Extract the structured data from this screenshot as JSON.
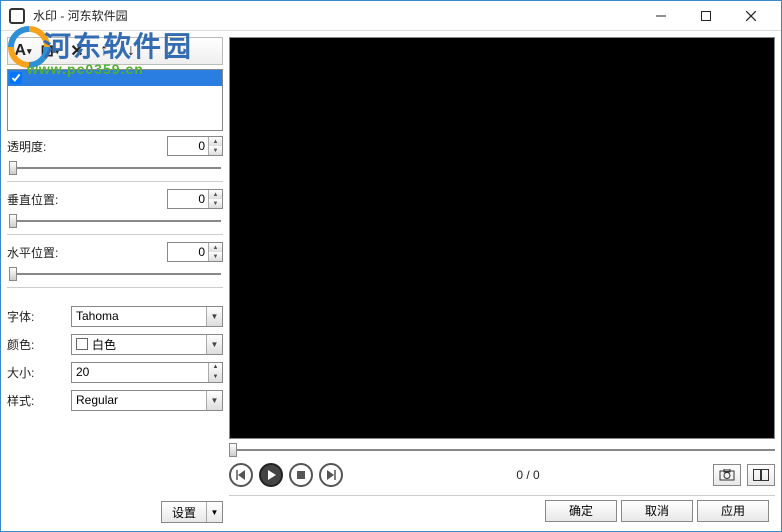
{
  "window": {
    "title": "水印 - 河东软件园"
  },
  "watermark": {
    "text": "河东软件园",
    "url": "www.pc0359.cn"
  },
  "toolbar": {
    "text_tool": "A",
    "image_tool": "⊡",
    "delete_tool": "✕",
    "up_tool": "↑",
    "down_tool": "↓"
  },
  "list": {
    "items": [
      {
        "checked": true,
        "label": ""
      }
    ]
  },
  "sliders": {
    "opacity": {
      "label": "透明度:",
      "value": "0"
    },
    "vpos": {
      "label": "垂直位置:",
      "value": "0"
    },
    "hpos": {
      "label": "水平位置:",
      "value": "0"
    }
  },
  "font_section": {
    "font": {
      "label": "字体:",
      "value": "Tahoma"
    },
    "color": {
      "label": "颜色:",
      "value": "白色"
    },
    "size": {
      "label": "大小:",
      "value": "20"
    },
    "style": {
      "label": "样式:",
      "value": "Regular"
    }
  },
  "settings_btn": "设置",
  "player": {
    "counter": "0 / 0"
  },
  "footer": {
    "ok": "确定",
    "cancel": "取消",
    "apply": "应用"
  }
}
